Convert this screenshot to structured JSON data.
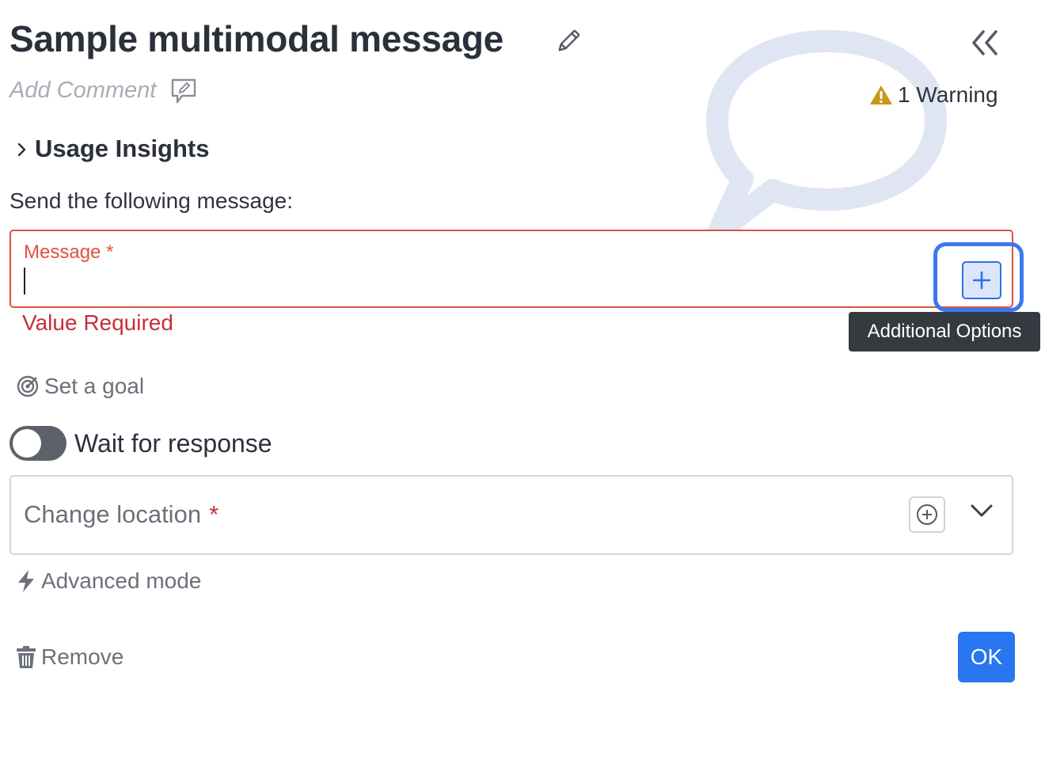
{
  "header": {
    "title": "Sample multimodal message",
    "add_comment_placeholder": "Add Comment",
    "warning_text": "1 Warning"
  },
  "insights": {
    "label": "Usage Insights"
  },
  "message_section": {
    "instruction": "Send the following message:",
    "field_label": "Message",
    "required_marker": "*",
    "value": "",
    "error_text": "Value Required",
    "tooltip": "Additional Options"
  },
  "goal": {
    "label": "Set a goal"
  },
  "wait": {
    "label": "Wait for response",
    "enabled": false
  },
  "location": {
    "placeholder": "Change location",
    "required_marker": "*"
  },
  "advanced": {
    "label": "Advanced mode"
  },
  "footer": {
    "remove_label": "Remove",
    "ok_label": "OK"
  },
  "colors": {
    "error": "#e0513f",
    "error_text": "#c72f38",
    "accent": "#2876f0",
    "warning": "#c9961a"
  },
  "icons": [
    "pencil-icon",
    "double-chevron-left-icon",
    "comment-edit-icon",
    "warning-icon",
    "chevron-right-icon",
    "plus-icon",
    "target-icon",
    "lightning-icon",
    "plus-circle-icon",
    "chevron-down-icon",
    "trash-icon",
    "speech-bubble-icon"
  ]
}
